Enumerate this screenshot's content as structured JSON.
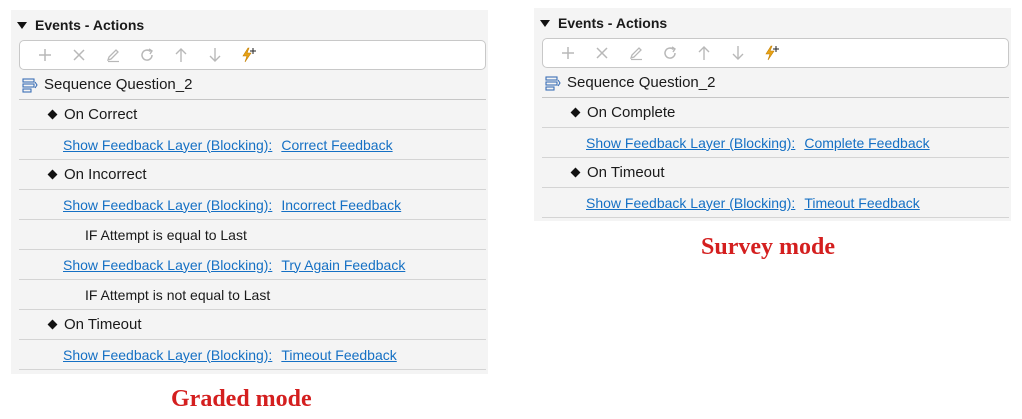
{
  "panels": {
    "graded": {
      "header": "Events - Actions",
      "root": "Sequence Question_2",
      "rows": [
        {
          "event": "On Correct"
        },
        {
          "action": "Show Feedback Layer (Blocking):",
          "target": "Correct Feedback"
        },
        {
          "event": "On Incorrect"
        },
        {
          "action": "Show Feedback Layer (Blocking):",
          "target": "Incorrect Feedback"
        },
        {
          "condition": "IF Attempt is equal to Last"
        },
        {
          "action": "Show Feedback Layer (Blocking):",
          "target": "Try Again Feedback"
        },
        {
          "condition": "IF Attempt is not equal to Last"
        },
        {
          "event": "On Timeout"
        },
        {
          "action": "Show Feedback Layer (Blocking):",
          "target": "Timeout Feedback"
        }
      ]
    },
    "survey": {
      "header": "Events - Actions",
      "root": "Sequence Question_2",
      "rows": [
        {
          "event": "On Complete"
        },
        {
          "action": "Show Feedback Layer (Blocking):",
          "target": "Complete Feedback"
        },
        {
          "event": "On Timeout"
        },
        {
          "action": "Show Feedback Layer (Blocking):",
          "target": "Timeout Feedback"
        }
      ]
    }
  },
  "captions": {
    "graded": "Graded mode",
    "survey": "Survey mode"
  },
  "toolbar_icons": [
    "add-icon",
    "delete-icon",
    "edit-icon",
    "refresh-icon",
    "move-up-icon",
    "move-down-icon",
    "add-trigger-icon"
  ],
  "colors": {
    "link": "#1570c4",
    "caption": "#d41f1f",
    "trigger_icon": "#e8a317",
    "panel_bg": "#f4f4f4"
  }
}
